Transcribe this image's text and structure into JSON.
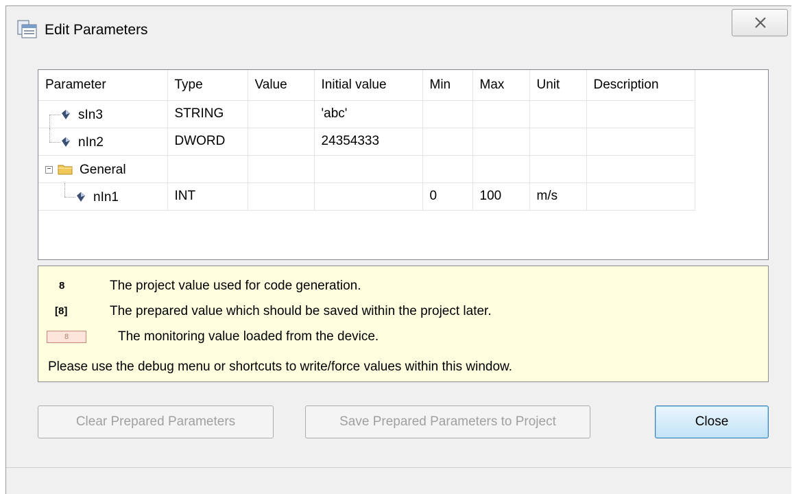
{
  "window": {
    "title": "Edit Parameters"
  },
  "table": {
    "columns": [
      "Parameter",
      "Type",
      "Value",
      "Initial value",
      "Min",
      "Max",
      "Unit",
      "Description"
    ],
    "rows": [
      {
        "name": "sIn3",
        "type": "STRING",
        "value": "",
        "initial": "'abc'",
        "min": "",
        "max": "",
        "unit": "",
        "description": ""
      },
      {
        "name": "nIn2",
        "type": "DWORD",
        "value": "",
        "initial": "24354333",
        "min": "",
        "max": "",
        "unit": "",
        "description": ""
      },
      {
        "name": "General",
        "type": "",
        "value": "",
        "initial": "",
        "min": "",
        "max": "",
        "unit": "",
        "description": ""
      },
      {
        "name": "nIn1",
        "type": "INT",
        "value": "",
        "initial": "",
        "min": "0",
        "max": "100",
        "unit": "m/s",
        "description": ""
      }
    ]
  },
  "legend": {
    "project_symbol": "8",
    "project_text": "The project value used for code generation.",
    "prepared_symbol": "[8]",
    "prepared_text": "The prepared value which should be saved within the project later.",
    "monitoring_symbol": "8",
    "monitoring_text": "The monitoring value loaded from the device.",
    "hint": "Please use the debug menu or shortcuts to write/force values within this window."
  },
  "buttons": {
    "clear": "Clear Prepared Parameters",
    "save": "Save Prepared Parameters to Project",
    "close": "Close"
  },
  "colors": {
    "legend_bg": "#ffffe0",
    "monitor_bg": "#fde5dc",
    "primary_button_border": "#3c7fb1"
  }
}
